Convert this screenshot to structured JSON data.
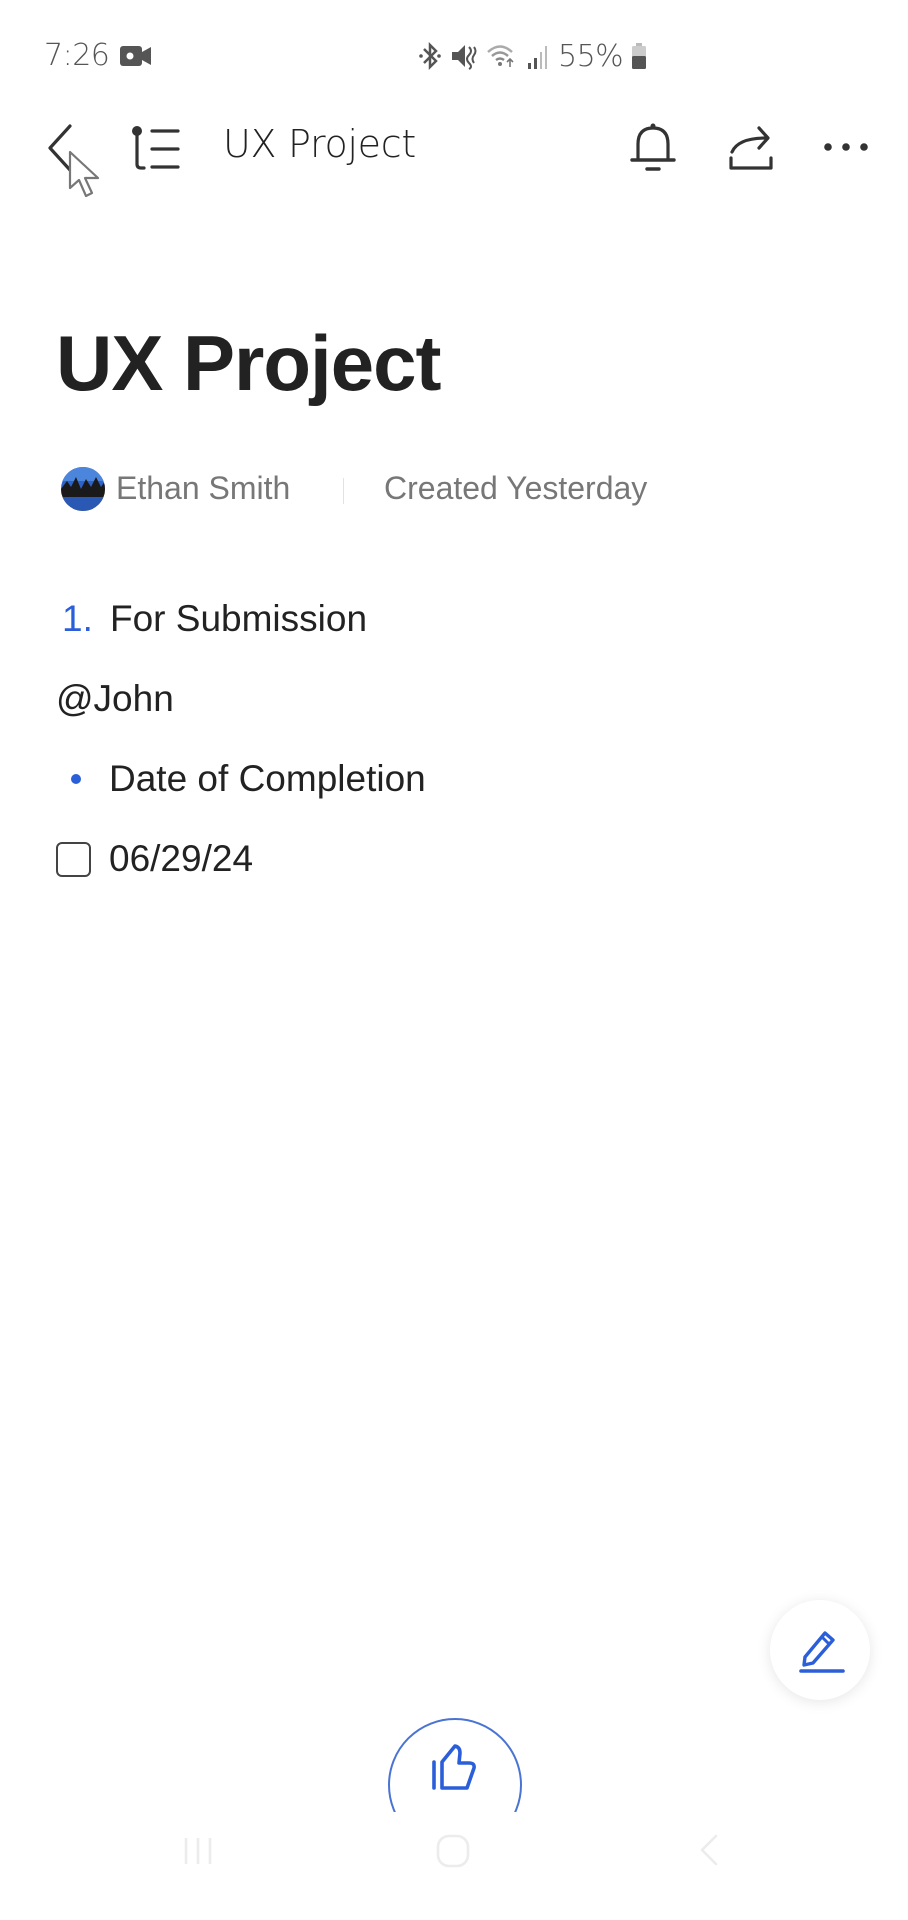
{
  "status_bar": {
    "time": "7:26",
    "battery_percent": "55%",
    "icons": [
      "screen-record-icon",
      "bluetooth-icon",
      "mute-icon",
      "wifi-icon",
      "signal-icon",
      "battery-icon"
    ]
  },
  "header": {
    "title": "UX Project",
    "icons": [
      "back-icon",
      "outline-icon",
      "bell-icon",
      "share-icon",
      "more-icon"
    ]
  },
  "document": {
    "title": "UX Project",
    "author": "Ethan Smith",
    "created": "Created Yesterday",
    "blocks": [
      {
        "type": "numbered",
        "marker": "1.",
        "text": "For Submission"
      },
      {
        "type": "mention",
        "text": "@John"
      },
      {
        "type": "bullet",
        "text": "Date of Completion"
      },
      {
        "type": "checkbox",
        "checked": false,
        "text": "06/29/24"
      }
    ]
  },
  "actions": {
    "edit_icon": "pencil-icon",
    "like_icon": "thumbs-up-icon"
  },
  "colors": {
    "accent": "#2b5fd9",
    "text": "#222222",
    "muted": "#777777"
  },
  "nav_bar": {
    "icons": [
      "recents-icon",
      "home-icon",
      "back-icon"
    ]
  }
}
